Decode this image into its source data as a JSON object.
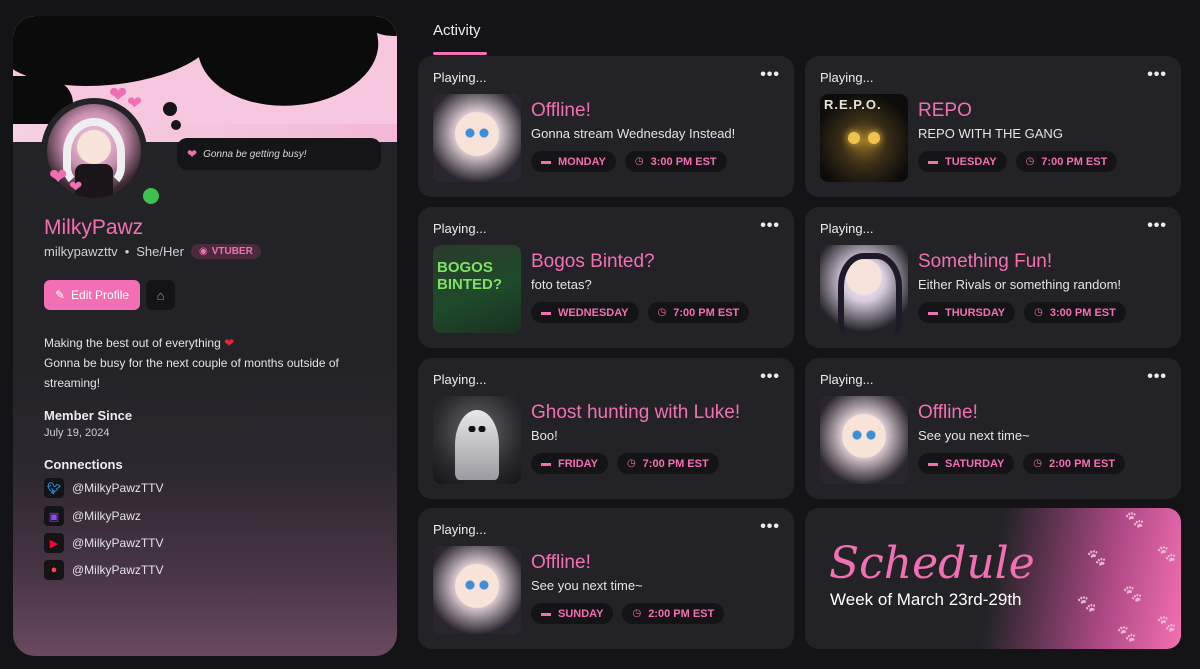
{
  "profile": {
    "status_text": "Gonna be getting busy!",
    "display_name": "MilkyPawz",
    "username": "milkypawzttv",
    "separator": "•",
    "pronouns": "She/Her",
    "badge": "VTUBER",
    "edit_label": "Edit Profile",
    "bio_line1": "Making the best out of everything",
    "bio_heart": "❤",
    "bio_line2": "Gonna be busy for the next couple of months outside of streaming!",
    "member_since_label": "Member Since",
    "member_since_value": "July 19, 2024",
    "connections_label": "Connections",
    "connections": [
      {
        "icon": "twitter-icon",
        "handle": "@MilkyPawzTTV",
        "color": "#1d9bf0"
      },
      {
        "icon": "twitch-icon",
        "handle": "@MilkyPawz",
        "color": "#9146ff"
      },
      {
        "icon": "youtube-icon",
        "handle": "@MilkyPawzTTV",
        "color": "#ff0033"
      },
      {
        "icon": "patreon-icon",
        "handle": "@MilkyPawzTTV",
        "color": "#ff424d"
      }
    ]
  },
  "activity": {
    "title": "Activity",
    "more": "•••",
    "cards": [
      {
        "playing": "Playing...",
        "title": "Offline!",
        "desc": "Gonna stream Wednesday Instead!",
        "day": "MONDAY",
        "time": "3:00 PM EST"
      },
      {
        "playing": "Playing...",
        "title": "REPO",
        "desc": "REPO WITH THE GANG",
        "day": "TUESDAY",
        "time": "7:00 PM EST",
        "thumb_text": "R.E.P.O."
      },
      {
        "playing": "Playing...",
        "title": "Bogos Binted?",
        "desc": "foto tetas?",
        "day": "WEDNESDAY",
        "time": "7:00 PM EST",
        "thumb_text": "BOGOS BINTED?"
      },
      {
        "playing": "Playing...",
        "title": "Something Fun!",
        "desc": "Either Rivals or something random!",
        "day": "THURSDAY",
        "time": "3:00 PM EST"
      },
      {
        "playing": "Playing...",
        "title": "Ghost hunting with Luke!",
        "desc": "Boo!",
        "day": "FRIDAY",
        "time": "7:00 PM EST"
      },
      {
        "playing": "Playing...",
        "title": "Offline!",
        "desc": "See you next time~",
        "day": "SATURDAY",
        "time": "2:00 PM EST"
      },
      {
        "playing": "Playing...",
        "title": "Offline!",
        "desc": "See you next time~",
        "day": "SUNDAY",
        "time": "2:00 PM EST"
      }
    ]
  },
  "schedule": {
    "title": "Schedule",
    "subtitle": "Week of March 23rd-29th"
  },
  "colors": {
    "accent": "#f36fb3",
    "card_bg": "#232327",
    "page_bg": "#141416",
    "online": "#3fbf4f"
  }
}
